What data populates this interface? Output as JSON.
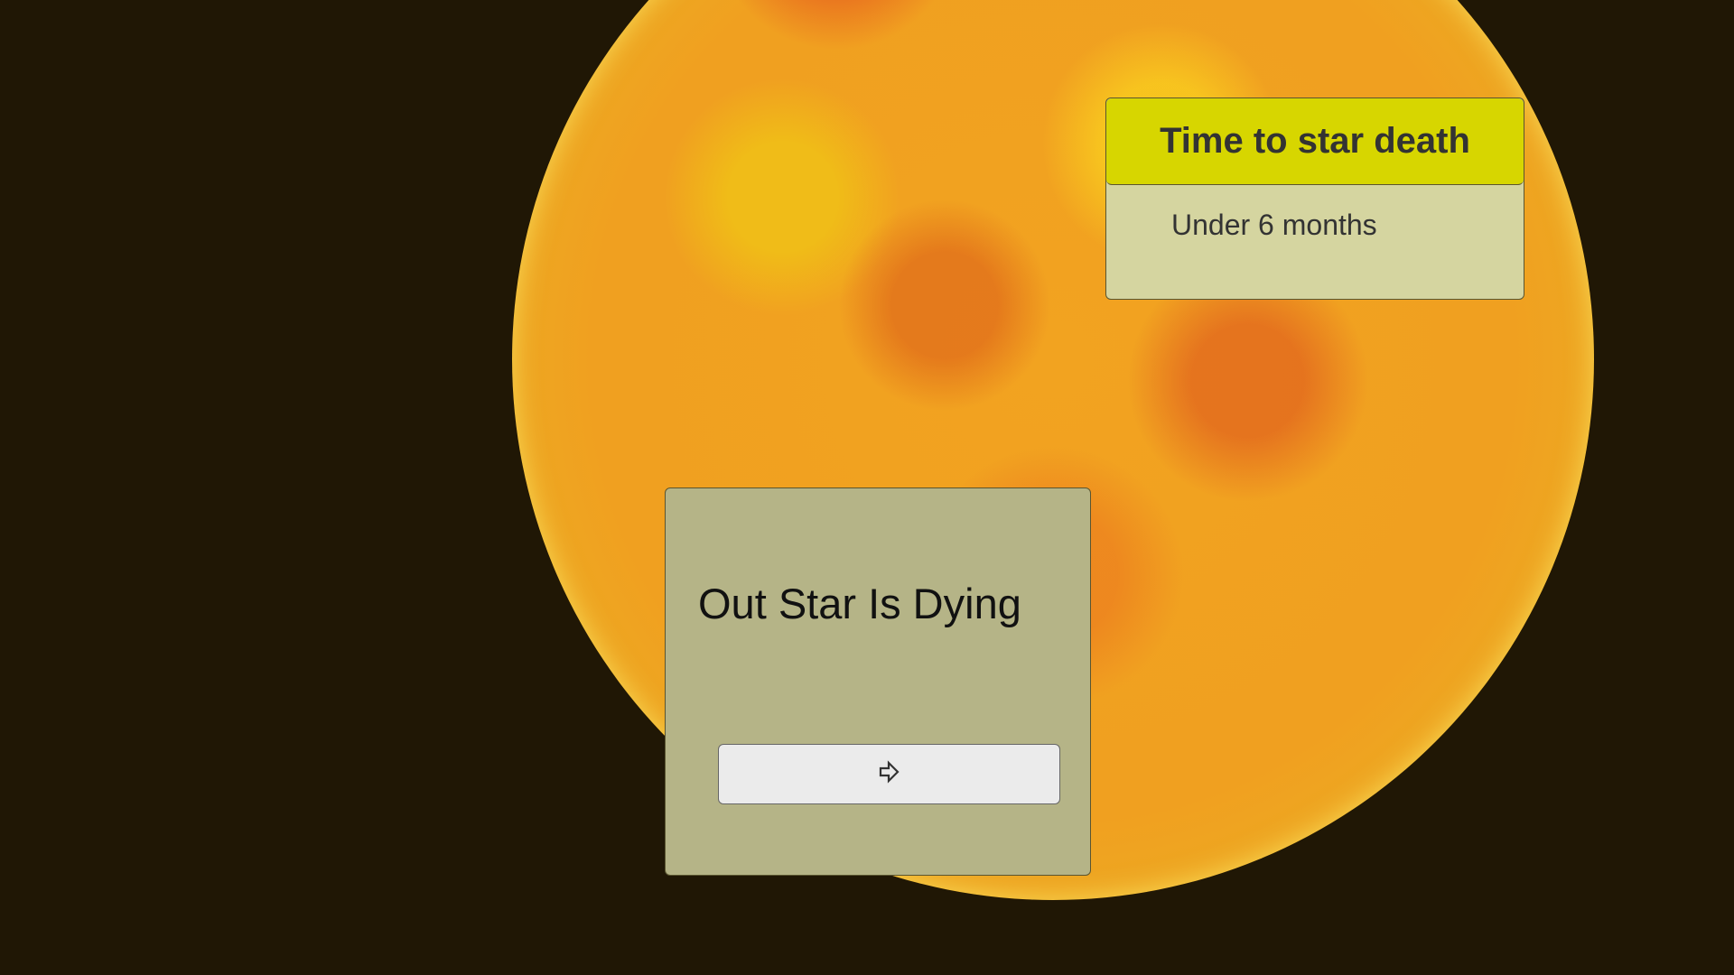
{
  "info_card": {
    "title": "Time to star death",
    "value": "Under 6 months"
  },
  "dialog": {
    "title": "Out Star Is Dying",
    "next_button_icon": "arrow-right-outline-icon"
  },
  "colors": {
    "background": "#201705",
    "header": "#d7d600",
    "card_body": "#d5d5a0",
    "dialog": "#b5b487",
    "button": "#ebebeb"
  }
}
